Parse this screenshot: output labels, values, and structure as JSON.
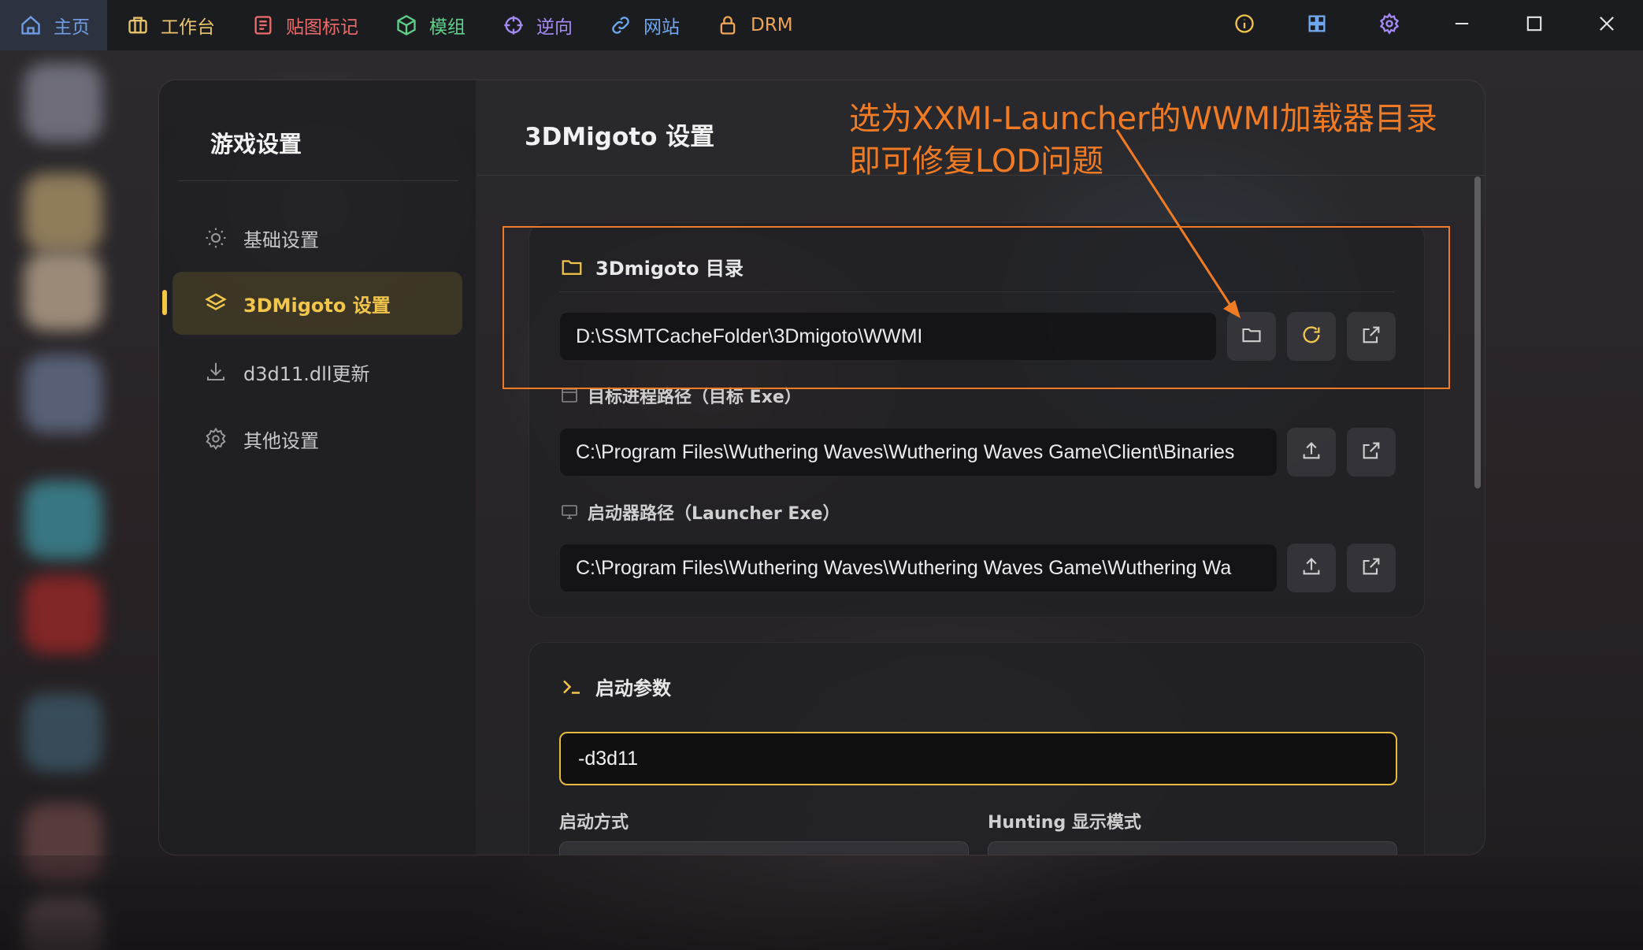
{
  "nav": {
    "items": [
      {
        "label": "主页",
        "icon": "home-icon",
        "color": "#6f9fe6"
      },
      {
        "label": "工作台",
        "icon": "briefcase-icon",
        "color": "#e9c46a"
      },
      {
        "label": "贴图标记",
        "icon": "document-list-icon",
        "color": "#ee6b6b"
      },
      {
        "label": "模组",
        "icon": "cube-icon",
        "color": "#5fd08a"
      },
      {
        "label": "逆向",
        "icon": "crosshair-icon",
        "color": "#a78bfa"
      },
      {
        "label": "网站",
        "icon": "link-icon",
        "color": "#6fa8f0"
      },
      {
        "label": "DRM",
        "icon": "lock-icon",
        "color": "#f0a455"
      }
    ],
    "right_icons": [
      "info-icon",
      "grid-icon",
      "settings-icon"
    ],
    "window_controls": [
      "minimize-icon",
      "maximize-icon",
      "close-icon"
    ]
  },
  "sidebar": {
    "title": "游戏设置",
    "items": [
      {
        "label": "基础设置",
        "icon": "sun-icon"
      },
      {
        "label": "3DMigoto 设置",
        "icon": "layers-icon"
      },
      {
        "label": "d3d11.dll更新",
        "icon": "download-icon"
      },
      {
        "label": "其他设置",
        "icon": "gear-icon"
      }
    ]
  },
  "content": {
    "title": "3DMigoto 设置",
    "dir_section": {
      "heading": "3Dmigoto 目录",
      "path": "D:\\SSMTCacheFolder\\3Dmigoto\\WWMI"
    },
    "target_section": {
      "label": "目标进程路径（目标 Exe）",
      "path": "C:\\Program Files\\Wuthering Waves\\Wuthering Waves Game\\Client\\Binaries"
    },
    "launcher_section": {
      "label": "启动器路径（Launcher Exe）",
      "path": "C:\\Program Files\\Wuthering Waves\\Wuthering Waves Game\\Wuthering Wa"
    },
    "args_section": {
      "heading": "启动参数",
      "value": "-d3d11",
      "launch_mode_label": "启动方式",
      "hunting_label": "Hunting 显示模式"
    }
  },
  "annotation": {
    "line1": "选为XXMI-Launcher的WWMI加载器目录",
    "line2": "即可修复LOD问题",
    "color": "#f07b24"
  },
  "colors": {
    "accent": "#f5c842",
    "active_nav_bg": "#2c3240"
  }
}
